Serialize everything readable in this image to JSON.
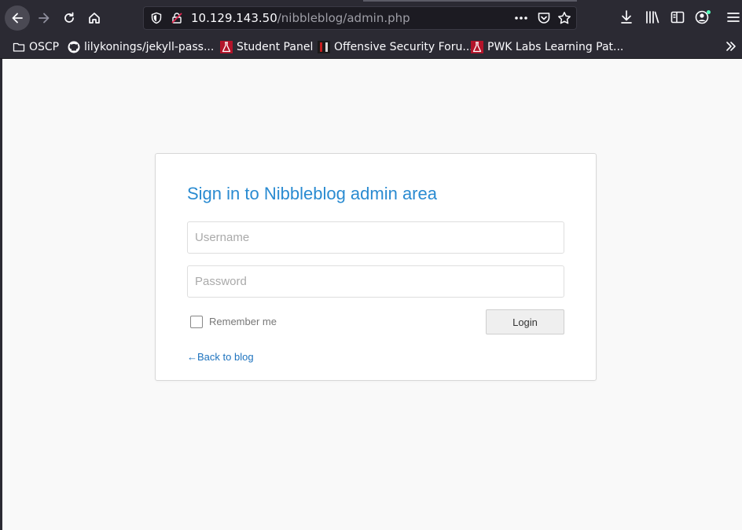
{
  "browser": {
    "url_host": "10.129.143.50",
    "url_path": "/nibbleblog/admin.php",
    "bookmarks": [
      {
        "label": "OSCP",
        "icon": "folder-icon"
      },
      {
        "label": "lilykonings/jekyll-pass...",
        "icon": "github-icon"
      },
      {
        "label": "Student Panel",
        "icon": "offsec-flask-icon"
      },
      {
        "label": "Offensive Security Foru...",
        "icon": "offsec-forum-icon"
      },
      {
        "label": "PWK Labs Learning Pat...",
        "icon": "offsec-flask-icon"
      }
    ]
  },
  "login": {
    "title": "Sign in to Nibbleblog admin area",
    "username_placeholder": "Username",
    "password_placeholder": "Password",
    "remember_label": "Remember me",
    "login_label": "Login",
    "back_link": "←Back to blog"
  },
  "colors": {
    "title": "#2a8bd1",
    "link": "#1e73be",
    "chrome_bg": "#2b2a33",
    "page_bg": "#f9f9f9"
  }
}
